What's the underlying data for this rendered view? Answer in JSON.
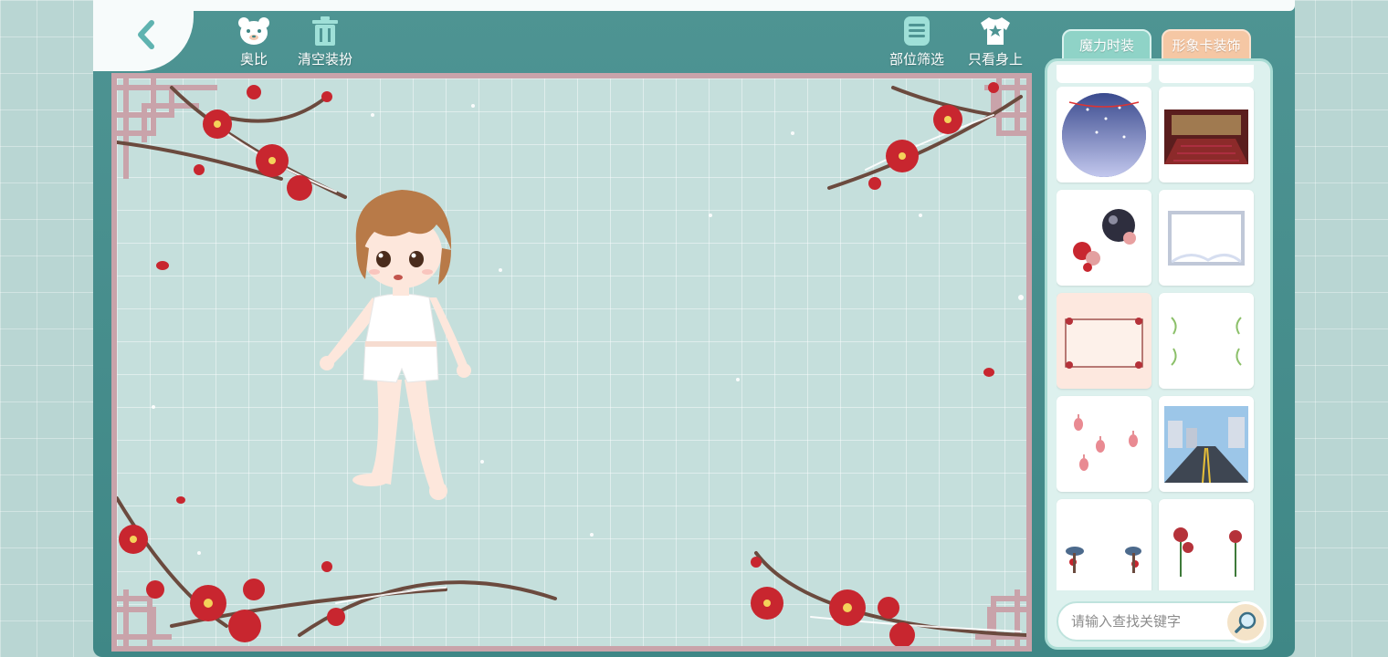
{
  "toolbar": {
    "obi_label": "奥比",
    "clear_label": "清空装扮",
    "filter_label": "部位筛选",
    "wearing_label": "只看身上"
  },
  "tabs": {
    "fashion": "魔力时装",
    "card": "形象卡装饰"
  },
  "search": {
    "placeholder": "请输入查找关键字"
  },
  "items": [
    {
      "icon": "snowy-night-circle-background",
      "selected": false
    },
    {
      "icon": "stage-hall-background",
      "selected": false
    },
    {
      "icon": "moon-flower-ornament",
      "selected": false
    },
    {
      "icon": "frosted-frame",
      "selected": false
    },
    {
      "icon": "plum-blossom-frame",
      "selected": true
    },
    {
      "icon": "green-vine-frame",
      "selected": false
    },
    {
      "icon": "red-lantern-ornaments",
      "selected": false
    },
    {
      "icon": "city-street-background",
      "selected": false
    },
    {
      "icon": "mushroom-ornaments",
      "selected": false
    },
    {
      "icon": "rose-ornaments",
      "selected": false
    }
  ],
  "colors": {
    "frame": "#4e9493",
    "stage_border": "#c9a3aa",
    "tab_fashion": "#8fd3c7",
    "tab_card": "#f5c7a4",
    "blossom": "#c8262f"
  }
}
